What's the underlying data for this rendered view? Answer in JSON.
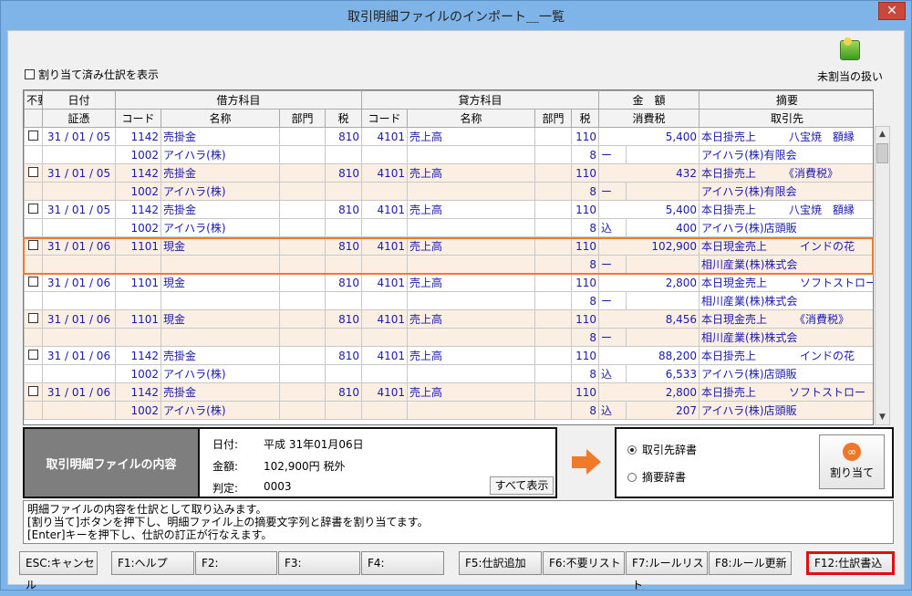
{
  "window": {
    "title": "取引明細ファイルのインポート＿一覧",
    "close_glyph": "✕"
  },
  "options": {
    "show_assigned_label": "割り当て済み仕訳を表示",
    "unassigned_label": "未割当の扱い"
  },
  "grid": {
    "group_headers": [
      "不要",
      "日付",
      "借方科目",
      "貸方科目",
      "金　額",
      "摘要"
    ],
    "sub_headers": [
      "証憑",
      "コード",
      "名称",
      "部門",
      "税",
      "コード",
      "名称",
      "部門",
      "税",
      "消費税",
      "取引先"
    ],
    "rows": [
      {
        "date": "31 / 01 / 05",
        "dcode": "1142",
        "dname": "売掛金",
        "dtax": "810",
        "ccode": "4101",
        "cname": "売上高",
        "ctax": "110",
        "amount": "5,400",
        "memo": "本日掛売上　　　八宝焼　額縁"
      },
      {
        "dcode": "1002",
        "dname": "アイハラ(株)",
        "ctax": "8",
        "taxmark": "ー",
        "taxamt": "",
        "memo": "アイハラ(株)有限会"
      },
      {
        "date": "31 / 01 / 05",
        "dcode": "1142",
        "dname": "売掛金",
        "dtax": "810",
        "ccode": "4101",
        "cname": "売上高",
        "ctax": "110",
        "amount": "432",
        "memo": "本日掛売上　　　《消費税》"
      },
      {
        "dcode": "1002",
        "dname": "アイハラ(株)",
        "ctax": "8",
        "taxmark": "ー",
        "taxamt": "",
        "memo": "アイハラ(株)有限会"
      },
      {
        "date": "31 / 01 / 05",
        "dcode": "1142",
        "dname": "売掛金",
        "dtax": "810",
        "ccode": "4101",
        "cname": "売上高",
        "ctax": "110",
        "amount": "5,400",
        "memo": "本日掛売上　　　八宝焼　額縁"
      },
      {
        "dcode": "1002",
        "dname": "アイハラ(株)",
        "ctax": "8",
        "taxmark": "込",
        "taxamt": "400",
        "memo": "アイハラ(株)店頭販"
      },
      {
        "date": "31 / 01 / 06",
        "dcode": "1101",
        "dname": "現金",
        "dtax": "810",
        "ccode": "4101",
        "cname": "売上高",
        "ctax": "110",
        "amount": "102,900",
        "memo": "本日現金売上　　　インドの花"
      },
      {
        "dcode": "",
        "dname": "",
        "ctax": "8",
        "taxmark": "ー",
        "taxamt": "",
        "memo": "相川産業(株)株式会"
      },
      {
        "date": "31 / 01 / 06",
        "dcode": "1101",
        "dname": "現金",
        "dtax": "810",
        "ccode": "4101",
        "cname": "売上高",
        "ctax": "110",
        "amount": "2,800",
        "memo": "本日現金売上　　　ソフトストロー"
      },
      {
        "dcode": "",
        "dname": "",
        "ctax": "8",
        "taxmark": "ー",
        "taxamt": "",
        "memo": "相川産業(株)株式会"
      },
      {
        "date": "31 / 01 / 06",
        "dcode": "1101",
        "dname": "現金",
        "dtax": "810",
        "ccode": "4101",
        "cname": "売上高",
        "ctax": "110",
        "amount": "8,456",
        "memo": "本日現金売上　　　《消費税》"
      },
      {
        "dcode": "",
        "dname": "",
        "ctax": "8",
        "taxmark": "ー",
        "taxamt": "",
        "memo": "相川産業(株)株式会"
      },
      {
        "date": "31 / 01 / 06",
        "dcode": "1142",
        "dname": "売掛金",
        "dtax": "810",
        "ccode": "4101",
        "cname": "売上高",
        "ctax": "110",
        "amount": "88,200",
        "memo": "本日掛売上　　　　インドの花"
      },
      {
        "dcode": "1002",
        "dname": "アイハラ(株)",
        "ctax": "8",
        "taxmark": "込",
        "taxamt": "6,533",
        "memo": "アイハラ(株)店頭販"
      },
      {
        "date": "31 / 01 / 06",
        "dcode": "1142",
        "dname": "売掛金",
        "dtax": "810",
        "ccode": "4101",
        "cname": "売上高",
        "ctax": "110",
        "amount": "2,800",
        "memo": "本日掛売上　　　ソフトストロー"
      },
      {
        "dcode": "1002",
        "dname": "アイハラ(株)",
        "ctax": "8",
        "taxmark": "込",
        "taxamt": "207",
        "memo": "アイハラ(株)店頭販"
      }
    ]
  },
  "detail": {
    "box_label": "取引明細ファイルの内容",
    "date_label": "日付:",
    "date_value": "平成 31年01月06日",
    "amount_label": "金額:",
    "amount_value": "102,900円 税外",
    "judge_label": "判定:",
    "judge_value": "0003",
    "show_all": "すべて表示"
  },
  "assign": {
    "radio1": "取引先辞書",
    "radio2": "摘要辞書",
    "button": "割り当て"
  },
  "message": [
    "明細ファイルの内容を仕訳として取り込みます。",
    "[割り当て]ボタンを押下し、明細ファイル上の摘要文字列と辞書を割り当てます。",
    "[Enter]キーを押下し、仕訳の訂正が行なえます。"
  ],
  "fkeys": [
    "ESC:キャンセル",
    "F1:ヘルプ",
    "F2:",
    "F3:",
    "F4:",
    "F5:仕訳追加",
    "F6:不要リスト",
    "F7:ルールリスト",
    "F8:ルール更新",
    "F12:仕訳書込"
  ]
}
